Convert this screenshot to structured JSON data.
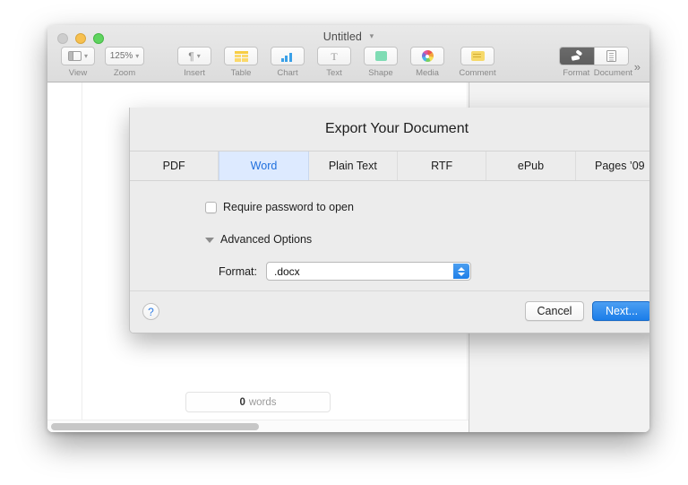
{
  "window": {
    "title": "Untitled",
    "title_chevron": "chevron-down-icon",
    "traffic_lights": {
      "close": "#cdcdcd",
      "minimize": "#f7c04f",
      "zoom": "#5fd45f"
    }
  },
  "toolbar": {
    "items": [
      {
        "label": "View",
        "icon": "window-layout-icon",
        "has_caret": true
      },
      {
        "label": "Zoom",
        "value": "125%",
        "icon": "zoom-value",
        "has_caret": true
      },
      {
        "label": "Insert",
        "icon": "pilcrow-icon",
        "glyph": "¶",
        "has_caret": true
      },
      {
        "label": "Table",
        "icon": "table-grid-icon"
      },
      {
        "label": "Chart",
        "icon": "bar-chart-icon"
      },
      {
        "label": "Text",
        "icon": "text-t-icon",
        "glyph": "T"
      },
      {
        "label": "Shape",
        "icon": "shape-square-icon"
      },
      {
        "label": "Media",
        "icon": "media-pinwheel-icon"
      },
      {
        "label": "Comment",
        "icon": "comment-note-icon"
      }
    ],
    "inspector_segments": [
      {
        "label": "Format",
        "icon": "paintbrush-icon",
        "active": true
      },
      {
        "label": "Document",
        "icon": "document-page-icon",
        "active": false
      }
    ],
    "overflow_glyph": "»"
  },
  "document": {
    "word_count_number": "0",
    "word_count_label": "words"
  },
  "sheet": {
    "title": "Export Your Document",
    "tabs": [
      {
        "label": "PDF",
        "active": false
      },
      {
        "label": "Word",
        "active": true
      },
      {
        "label": "Plain Text",
        "active": false
      },
      {
        "label": "RTF",
        "active": false
      },
      {
        "label": "ePub",
        "active": false
      },
      {
        "label": "Pages ’09",
        "active": false
      }
    ],
    "require_password": {
      "label": "Require password to open",
      "checked": false
    },
    "advanced_options": {
      "label": "Advanced Options",
      "expanded": true,
      "disclosure_icon": "triangle-down-icon"
    },
    "format_field": {
      "label": "Format:",
      "value": ".docx",
      "stepper_icon": "stepper-up-down-icon"
    },
    "footer": {
      "help_label": "?",
      "cancel_label": "Cancel",
      "next_label": "Next..."
    }
  },
  "colors": {
    "accent_blue": "#1b7de9",
    "tab_selected_bg": "#ddeaff",
    "tab_selected_text": "#1f6fdd",
    "sheet_bg": "#ececec",
    "toolbar_bg": "#e4e4e4"
  }
}
